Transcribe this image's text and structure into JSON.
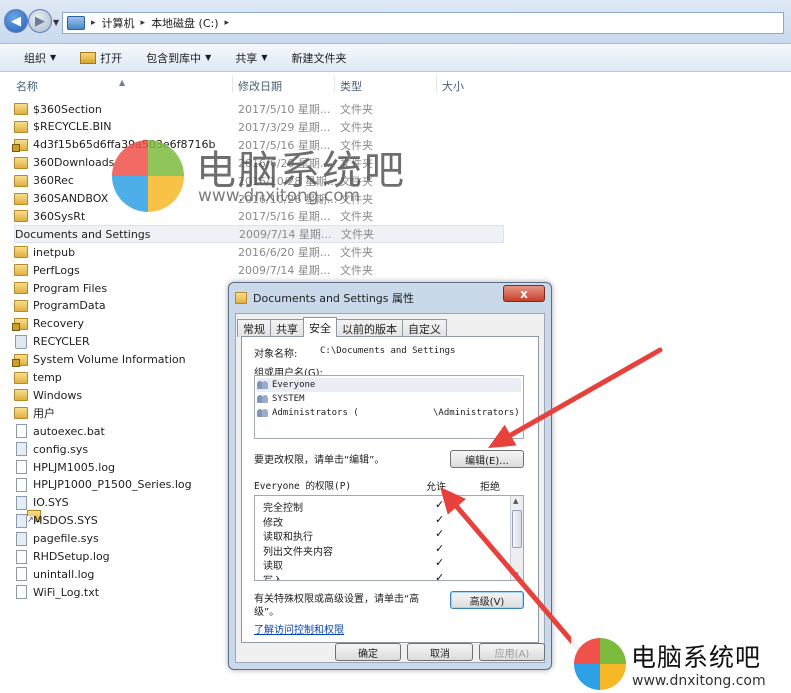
{
  "breadcrumb": [
    "计算机",
    "本地磁盘 (C:)"
  ],
  "toolbar": {
    "organize": "组织",
    "open": "打开",
    "include_library": "包含到库中",
    "share": "共享",
    "new_folder": "新建文件夹"
  },
  "columns": {
    "name": "名称",
    "modified": "修改日期",
    "type": "类型",
    "size": "大小"
  },
  "files": [
    {
      "name": "$360Section",
      "date": "2017/5/10 星期...",
      "type": "文件夹",
      "icon": "folder-icon"
    },
    {
      "name": "$RECYCLE.BIN",
      "date": "2017/3/29 星期...",
      "type": "文件夹",
      "icon": "folder-icon"
    },
    {
      "name": "4d3f15b65d6ffa39a503e6f8716b",
      "date": "2017/5/16 星期...",
      "type": "文件夹",
      "icon": "locked-folder-icon"
    },
    {
      "name": "360Downloads",
      "date": "2016/6/20 星期...",
      "type": "文件夹",
      "icon": "folder-icon"
    },
    {
      "name": "360Rec",
      "date": "2016/10/28 星期...",
      "type": "文件夹",
      "icon": "folder-icon"
    },
    {
      "name": "360SANDBOX",
      "date": "2016/10/26 星期...",
      "type": "文件夹",
      "icon": "folder-icon"
    },
    {
      "name": "360SysRt",
      "date": "2017/5/16 星期...",
      "type": "文件夹",
      "icon": "folder-icon"
    },
    {
      "name": "Documents and Settings",
      "date": "2009/7/14 星期...",
      "type": "文件夹",
      "icon": "shortcut-folder-icon",
      "selected": true
    },
    {
      "name": "inetpub",
      "date": "2016/6/20 星期...",
      "type": "文件夹",
      "icon": "folder-icon"
    },
    {
      "name": "PerfLogs",
      "date": "2009/7/14 星期...",
      "type": "文件夹",
      "icon": "folder-icon"
    },
    {
      "name": "Program Files",
      "date": "",
      "type": "",
      "icon": "folder-icon"
    },
    {
      "name": "ProgramData",
      "date": "",
      "type": "",
      "icon": "folder-icon"
    },
    {
      "name": "Recovery",
      "date": "",
      "type": "",
      "icon": "locked-folder-icon"
    },
    {
      "name": "RECYCLER",
      "date": "",
      "type": "",
      "icon": "recycle-icon"
    },
    {
      "name": "System Volume Information",
      "date": "",
      "type": "",
      "icon": "locked-folder-icon"
    },
    {
      "name": "temp",
      "date": "",
      "type": "",
      "icon": "folder-icon"
    },
    {
      "name": "Windows",
      "date": "",
      "type": "",
      "icon": "folder-icon"
    },
    {
      "name": "用户",
      "date": "",
      "type": "",
      "icon": "folder-icon"
    },
    {
      "name": "autoexec.bat",
      "date": "",
      "type": "",
      "icon": "file-icon"
    },
    {
      "name": "config.sys",
      "date": "",
      "type": "",
      "icon": "sysfile-icon"
    },
    {
      "name": "HPLJM1005.log",
      "date": "",
      "type": "",
      "icon": "file-icon"
    },
    {
      "name": "HPLJP1000_P1500_Series.log",
      "date": "",
      "type": "",
      "icon": "file-icon"
    },
    {
      "name": "IO.SYS",
      "date": "",
      "type": "",
      "icon": "sysfile-icon"
    },
    {
      "name": "MSDOS.SYS",
      "date": "",
      "type": "",
      "icon": "sysfile-icon"
    },
    {
      "name": "pagefile.sys",
      "date": "",
      "type": "",
      "icon": "sysfile-icon"
    },
    {
      "name": "RHDSetup.log",
      "date": "",
      "type": "",
      "icon": "file-icon"
    },
    {
      "name": "unintall.log",
      "date": "",
      "type": "",
      "icon": "file-icon"
    },
    {
      "name": "WiFi_Log.txt",
      "date": "",
      "type": "",
      "icon": "file-icon"
    }
  ],
  "watermark": {
    "text": "电脑系统吧",
    "url": "www.dnxitong.com"
  },
  "dialog": {
    "title": "Documents and Settings 属性",
    "close": "x",
    "tabs": [
      "常规",
      "共享",
      "安全",
      "以前的版本",
      "自定义"
    ],
    "active_tab": "安全",
    "object_label": "对象名称:",
    "object_value": "C:\\Documents and Settings",
    "group_label": "组或用户名(G):",
    "users": [
      {
        "name": "Everyone",
        "extra": ""
      },
      {
        "name": "SYSTEM",
        "extra": ""
      },
      {
        "name": "Administrators (",
        "extra": "\\Administrators)"
      }
    ],
    "change_hint": "要更改权限，请单击“编辑”。",
    "edit_button": "编辑(E)...",
    "perm_header": "Everyone 的权限(P)",
    "allow_col": "允许",
    "deny_col": "拒绝",
    "permissions": [
      {
        "name": "完全控制",
        "allow": "✓"
      },
      {
        "name": "修改",
        "allow": "✓"
      },
      {
        "name": "读取和执行",
        "allow": "✓"
      },
      {
        "name": "列出文件夹内容",
        "allow": "✓"
      },
      {
        "name": "读取",
        "allow": "✓"
      },
      {
        "name": "写入",
        "allow": "✓"
      }
    ],
    "special_hint_1": "有关特殊权限或高级设置，请单击“高",
    "special_hint_2": "级”。",
    "advanced_button": "高级(V)",
    "link_text": "了解访问控制和权限",
    "ok": "确定",
    "cancel": "取消",
    "apply": "应用(A)"
  },
  "colors": {
    "arrow": "#e8413c",
    "link": "#0645ad",
    "titlebar": "#c9d9ea"
  }
}
